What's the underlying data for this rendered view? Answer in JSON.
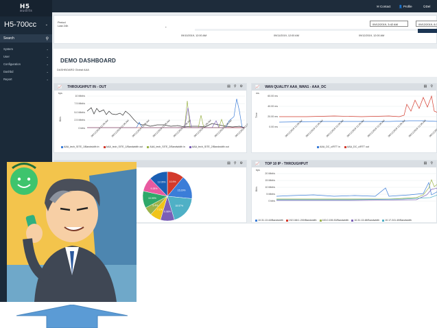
{
  "brand": {
    "logo_text": "H5",
    "logo_sub": "audits",
    "model": "H5-700cc"
  },
  "sidebar": {
    "search_label": "Search",
    "items": [
      {
        "label": "System"
      },
      {
        "label": "User"
      },
      {
        "label": "Configuration"
      },
      {
        "label": "Dashbd"
      },
      {
        "label": "Report"
      }
    ]
  },
  "topbar": {
    "contact": "Contact",
    "profile": "Profile",
    "more": "Del"
  },
  "period": {
    "label": "Period",
    "value": "Last 24h",
    "date_from": "09/12/2019, 3:42 AM",
    "date_to": "09/12/2019, 8:34",
    "timeline_labels": [
      "09/10/2019, 12:00 AM",
      "09/11/2019, 12:00 AM",
      "09/12/2019, 12:00 AM"
    ]
  },
  "dashboard": {
    "title": "DEMO DASHBOARD",
    "subtitle": "DASHBOARD Global AAA"
  },
  "widgets": [
    {
      "title": "THROUGHPUT IN - OUT",
      "unit": "bps",
      "yticks": [
        "10 Mbit/s",
        "7.5 Mbit/s",
        "5.0 Mbit/s",
        "2.5 Mbit/s",
        "0 bit/s"
      ],
      "ylabel": "Bit/s",
      "legend": [
        "AAA_tech_SITE_1/Bandwidth in",
        "AAA_tech_SITE_1/Bandwidth out",
        "AAA_tech_SITE_2/Bandwidth in",
        "AAA_tech_SITE_2/Bandwidth out"
      ],
      "legend_colors": [
        "#3b7dd8",
        "#d33a2c",
        "#9bb34a",
        "#7b5fb7"
      ]
    },
    {
      "title": "WAN QUALITY AAA_WAN1 - AAA_DC",
      "unit": "ms",
      "yticks": [
        "60.00 ms",
        "40.00 ms",
        "20.00 ms",
        "0.00 ms"
      ],
      "ylabel": "Time",
      "legend": [
        "AAA_DC_c/RTT in",
        "AAA_DC_c/RTT out"
      ],
      "legend_colors": [
        "#3b7dd8",
        "#d33a2c"
      ]
    },
    {
      "title": "",
      "legend": []
    },
    {
      "title": "TOP 10 IP - THROUGHPUT",
      "unit": "bps",
      "yticks": [
        "20 Mbit/s",
        "15 Mbit/s",
        "10 Mbit/s",
        "5 Mbit/s",
        "0 bit/s"
      ],
      "ylabel": "Bit/s",
      "legend": [
        "10.31.13.44/Bandwidth",
        "192.168.1.200/Bandwidth",
        "100.0.155.30/Bandwidth",
        "10.31.13.48/Bandwidth",
        "10.17.241.40/Bandwidth"
      ],
      "legend_colors": [
        "#3b7dd8",
        "#d33a2c",
        "#9bb34a",
        "#7b5fb7",
        "#4fb0c6"
      ]
    }
  ],
  "pie": {
    "labels": [
      "10.9%",
      "15.29%",
      "18.57%",
      "9.08%",
      "7.1%",
      "5.4%",
      "10.99%",
      "9.28%",
      "12.05%"
    ],
    "colors": [
      "#d33a2c",
      "#3b7dd8",
      "#4fb0c6",
      "#7b5fb7",
      "#f0c419",
      "#9bb34a",
      "#2ea86a",
      "#e85aa0",
      "#1a5fb4"
    ]
  },
  "xtick_label": "09/12/2019 12:00 AM"
}
